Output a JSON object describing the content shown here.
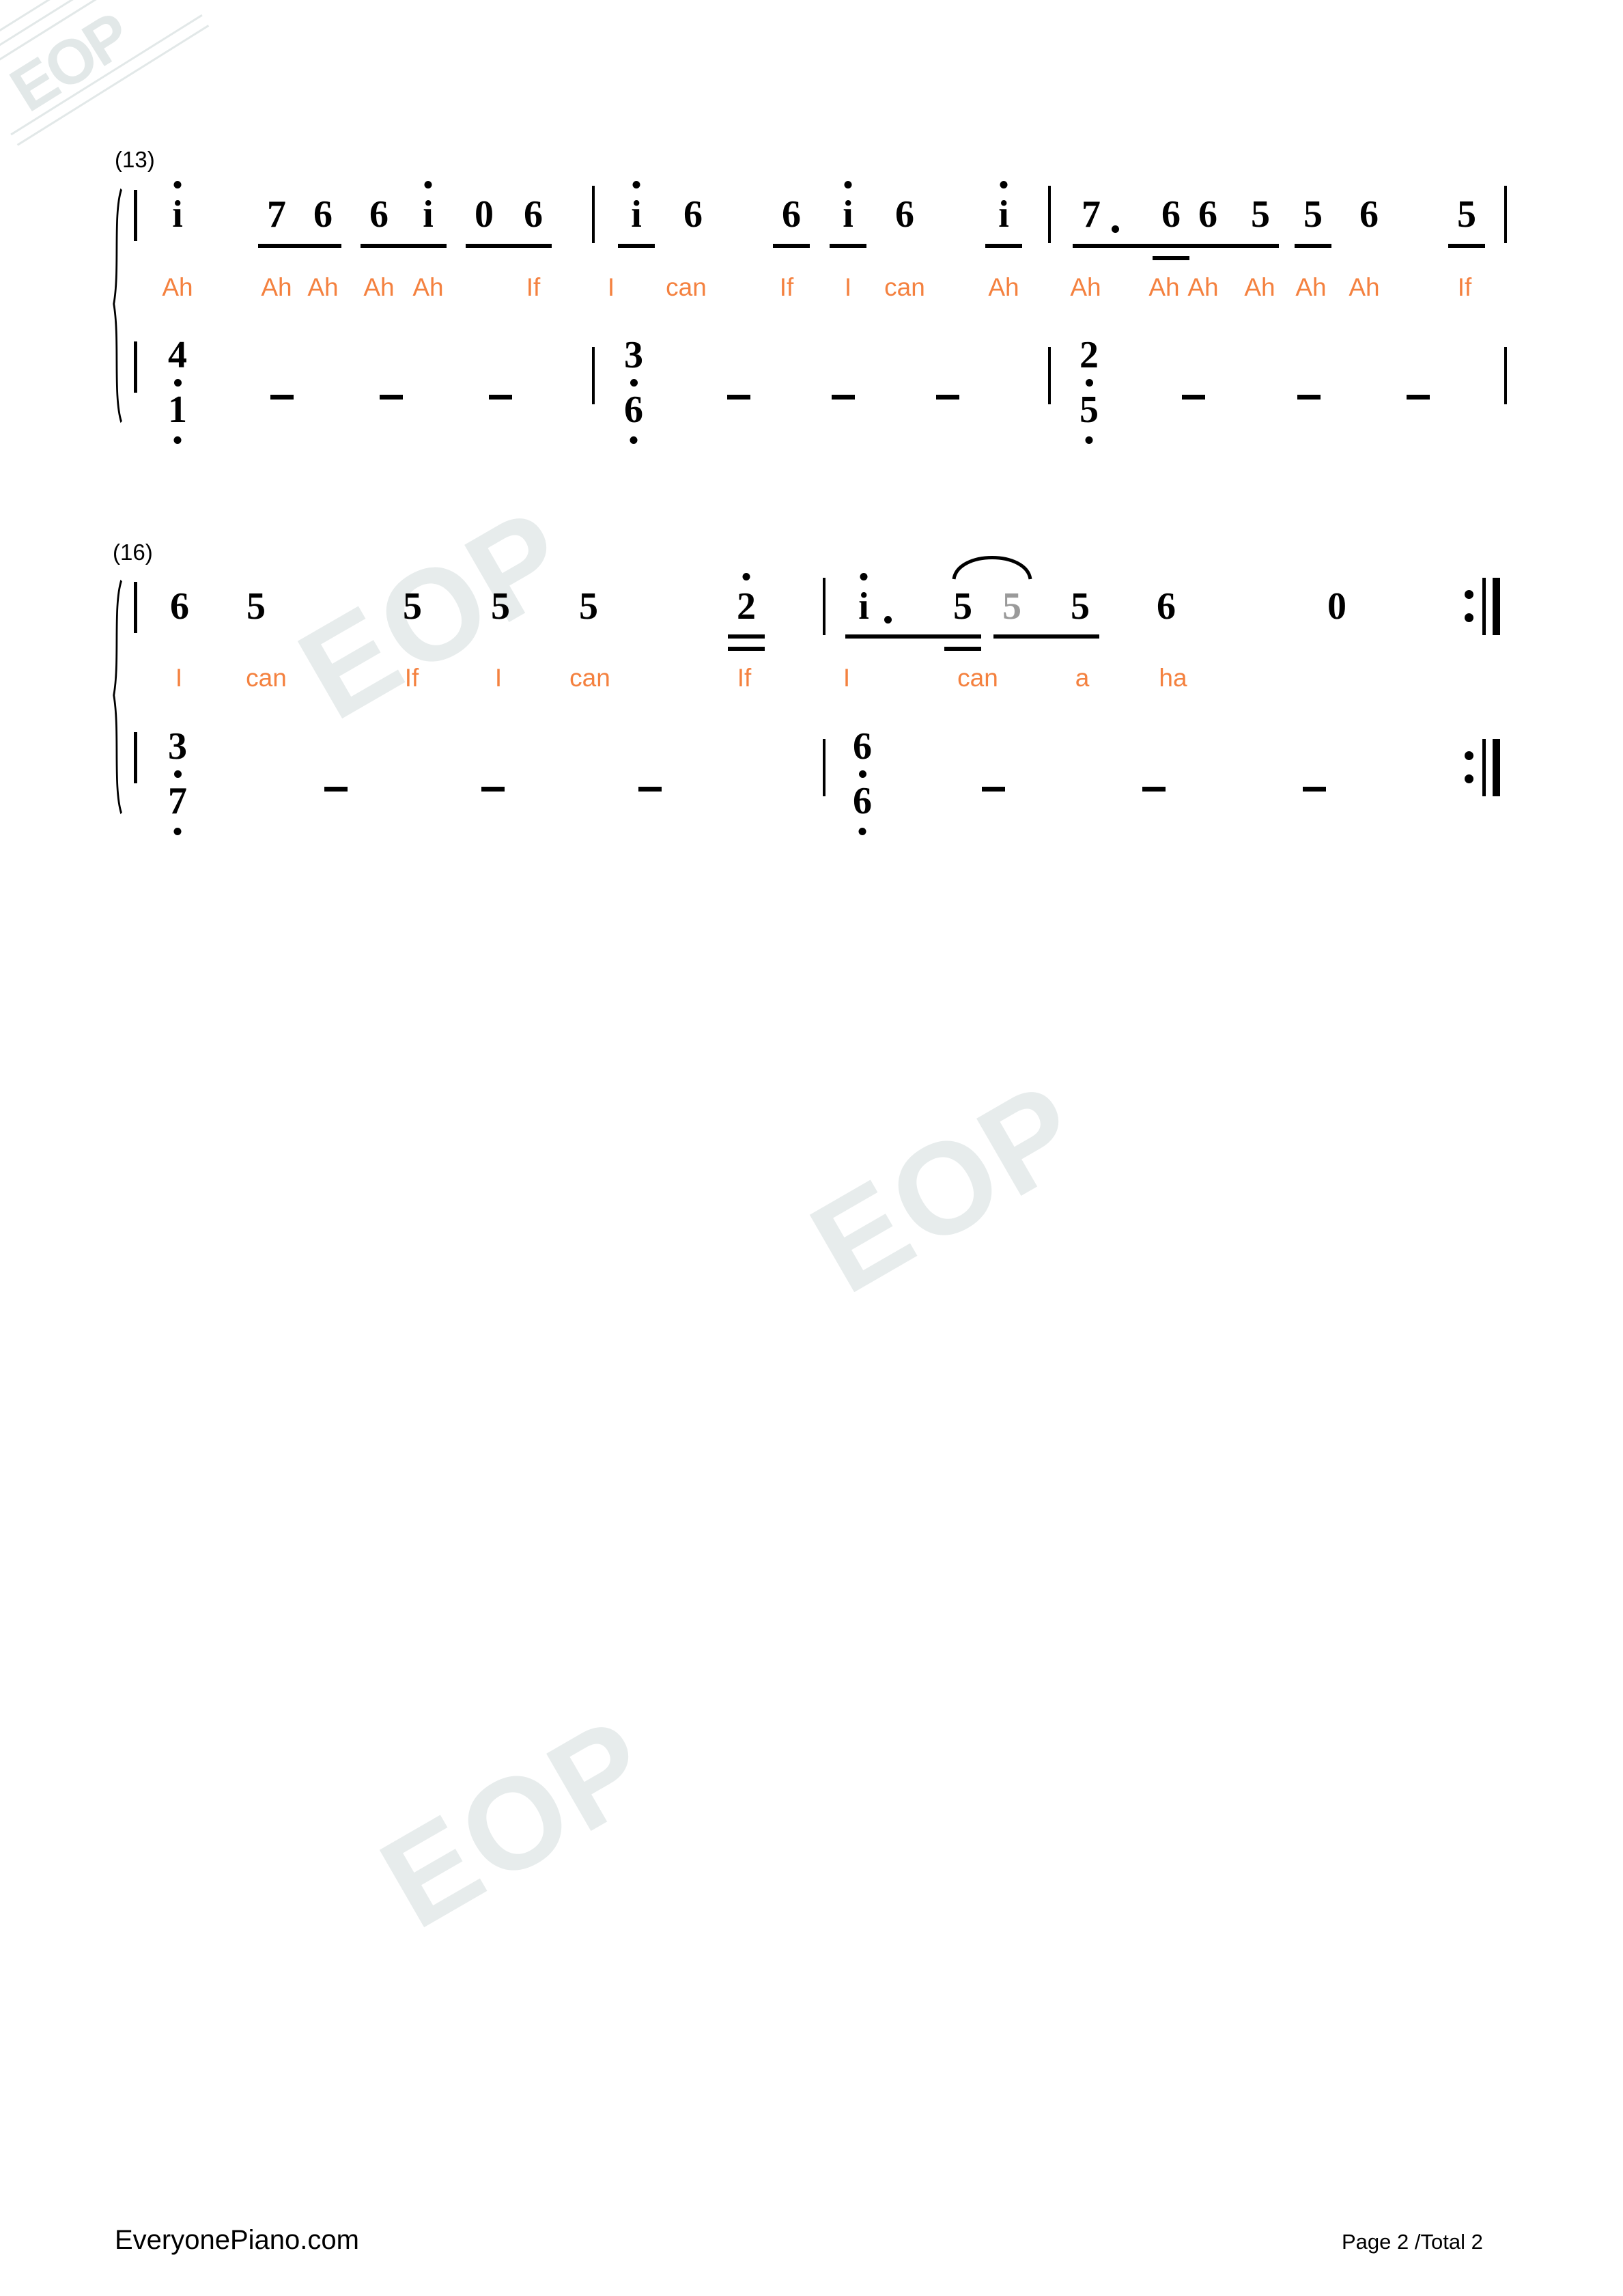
{
  "document": {
    "type": "numbered-musical-notation-jianpu",
    "page_label": "Page 2 /Total 2",
    "site": "EveryonePiano.com",
    "watermark_text": "EOP",
    "lyric_color": "#f4813f",
    "tied_note_color": "#9a9a9a"
  },
  "systems": [
    {
      "measure_label": "(13)",
      "melody_notes": [
        {
          "value": "i",
          "octave_up": true
        },
        {
          "value": "7"
        },
        {
          "value": "6"
        },
        {
          "value": "6"
        },
        {
          "value": "i",
          "octave_up": true
        },
        {
          "value": "0"
        },
        {
          "value": "6"
        },
        {
          "value": "i",
          "octave_up": true
        },
        {
          "value": "6"
        },
        {
          "value": "6"
        },
        {
          "value": "i",
          "octave_up": true
        },
        {
          "value": "6"
        },
        {
          "value": "i",
          "octave_up": true
        },
        {
          "value": "7",
          "dotted": true
        },
        {
          "value": "6"
        },
        {
          "value": "6"
        },
        {
          "value": "5"
        },
        {
          "value": "5"
        },
        {
          "value": "6"
        },
        {
          "value": "5"
        }
      ],
      "lyrics": [
        "Ah",
        "Ah",
        "Ah",
        "Ah",
        "Ah",
        "If",
        "I",
        "can",
        "If",
        "I",
        "can",
        "Ah",
        "Ah",
        "Ah",
        "Ah",
        "Ah",
        "Ah",
        "Ah",
        "If"
      ],
      "bass_chords": [
        {
          "top": "4",
          "bottom": "1",
          "bottom_octave_down": true
        },
        {
          "top": "3",
          "bottom": "6",
          "bottom_octave_down": true
        },
        {
          "top": "2",
          "bottom": "5",
          "bottom_octave_down": true
        }
      ],
      "sustain_dashes_per_chord": 3
    },
    {
      "measure_label": "(16)",
      "melody_notes": [
        {
          "value": "6"
        },
        {
          "value": "5"
        },
        {
          "value": "5"
        },
        {
          "value": "5"
        },
        {
          "value": "5"
        },
        {
          "value": "2",
          "octave_up": true
        },
        {
          "value": "i",
          "octave_up": true,
          "dotted": true
        },
        {
          "value": "5"
        },
        {
          "value": "5",
          "tied_grey": true
        },
        {
          "value": "5"
        },
        {
          "value": "6"
        },
        {
          "value": "0"
        }
      ],
      "lyrics": [
        "I",
        "can",
        "If",
        "I",
        "can",
        "If",
        "I",
        "can",
        "a",
        "ha"
      ],
      "bass_chords": [
        {
          "top": "3",
          "bottom": "7",
          "bottom_octave_down": true
        },
        {
          "top": "6",
          "bottom": "6",
          "bottom_octave_down": true
        }
      ],
      "sustain_dashes_per_chord": 3,
      "ends_with_repeat": true
    }
  ],
  "footer": {
    "left": "EveryonePiano.com",
    "right": "Page 2 /Total 2"
  }
}
